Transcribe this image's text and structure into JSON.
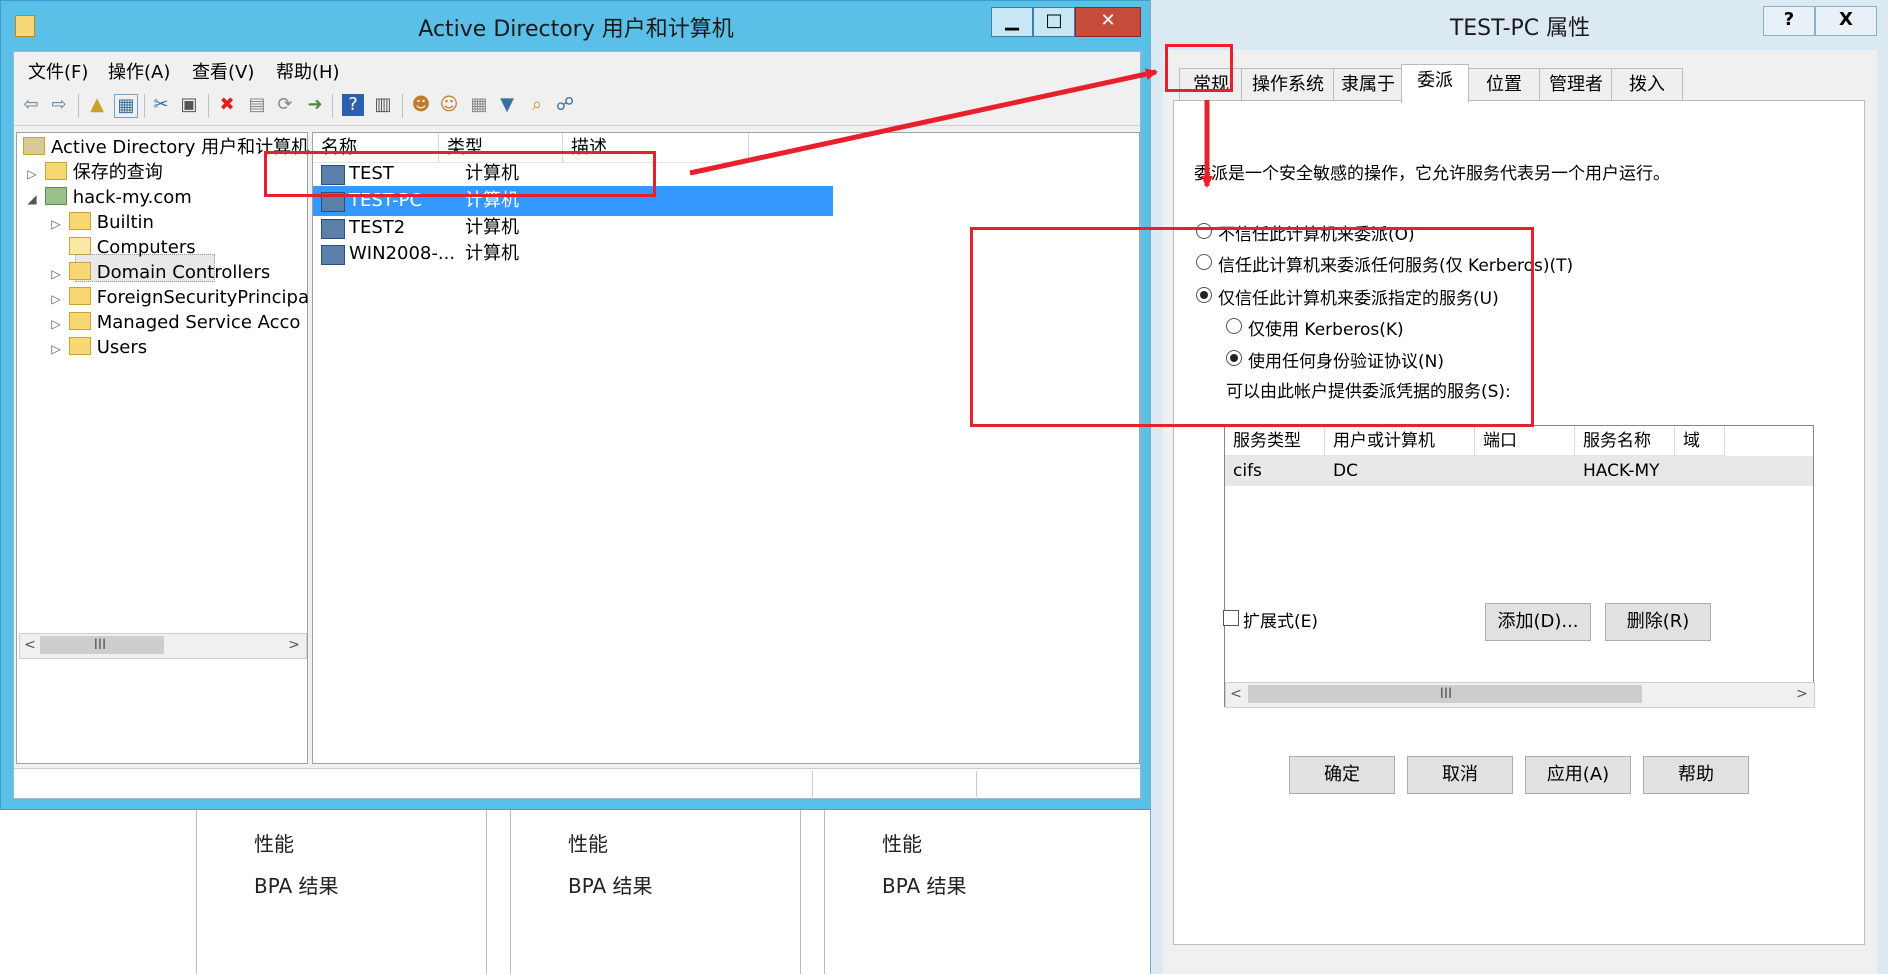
{
  "background": {
    "items": [
      {
        "perf": "性能",
        "bpa": "BPA 结果"
      },
      {
        "perf": "性能",
        "bpa": "BPA 结果"
      },
      {
        "perf": "性能",
        "bpa": "BPA 结果"
      }
    ]
  },
  "aduc": {
    "title": "Active Directory 用户和计算机",
    "menu": [
      "文件(F)",
      "操作(A)",
      "查看(V)",
      "帮助(H)"
    ],
    "tree": {
      "root": "Active Directory 用户和计算机",
      "saved_queries": "保存的查询",
      "domain": "hack-my.com",
      "children": [
        "Builtin",
        "Computers",
        "Domain Controllers",
        "ForeignSecurityPrincipa",
        "Managed Service Acco",
        "Users"
      ]
    },
    "list": {
      "headers": [
        "名称",
        "类型",
        "描述"
      ],
      "rows": [
        {
          "name": "TEST",
          "type": "计算机"
        },
        {
          "name": "TEST-PC",
          "type": "计算机"
        },
        {
          "name": "TEST2",
          "type": "计算机"
        },
        {
          "name": "WIN2008-...",
          "type": "计算机"
        }
      ]
    },
    "scroll_grip": "III"
  },
  "props": {
    "title": "TEST-PC 属性",
    "help_btn": "?",
    "close_btn": "X",
    "tabs": [
      "常规",
      "操作系统",
      "隶属于",
      "委派",
      "位置",
      "管理者",
      "拨入"
    ],
    "intro": "委派是一个安全敏感的操作，它允许服务代表另一个用户运行。",
    "opt_no_trust": "不信任此计算机来委派(O)",
    "opt_trust_any": "信任此计算机来委派任何服务(仅 Kerberos)(T)",
    "opt_trust_specified": "仅信任此计算机来委派指定的服务(U)",
    "opt_kerberos_only": "仅使用 Kerberos(K)",
    "opt_any_protocol": "使用任何身份验证协议(N)",
    "services_label": "可以由此帐户提供委派凭据的服务(S):",
    "grid_headers": [
      "服务类型",
      "用户或计算机",
      "端口",
      "服务名称",
      "域"
    ],
    "grid_rows": [
      {
        "service_type": "cifs",
        "user_or_computer": "DC",
        "port": "",
        "service_name": "HACK-MY",
        "domain": ""
      }
    ],
    "expanded_label": "扩展式(E)",
    "add_btn": "添加(D)...",
    "remove_btn": "删除(R)",
    "ok_btn": "确定",
    "cancel_btn": "取消",
    "apply_btn": "应用(A)",
    "help_button": "帮助"
  },
  "colors": {
    "annotation": "#e8202e",
    "selection": "#3399ff",
    "titlebar": "#5bc0e8"
  }
}
